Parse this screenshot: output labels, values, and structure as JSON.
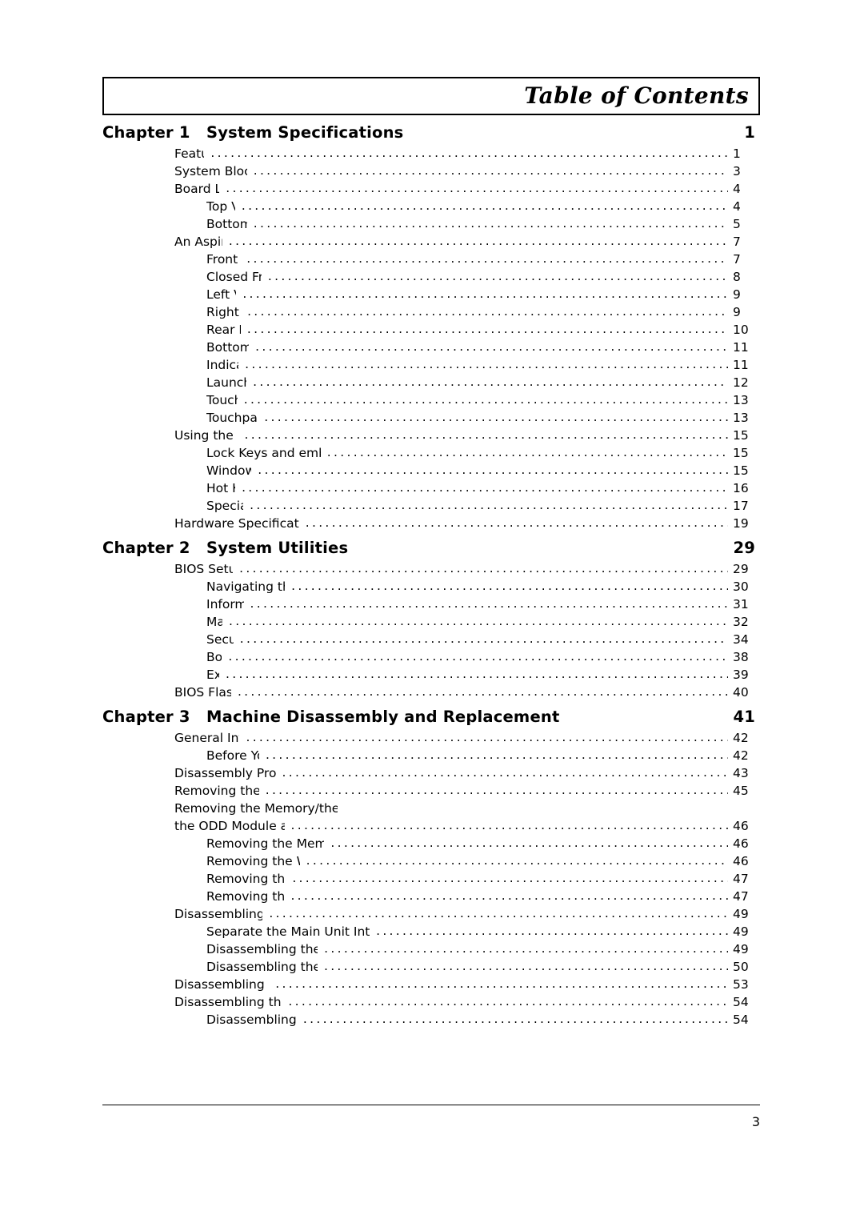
{
  "banner": {
    "title": "Table of Contents"
  },
  "footer": {
    "page_number": "3"
  },
  "chapters": [
    {
      "label": "Chapter 1",
      "title": "System Specifications",
      "page": "1",
      "entries": [
        {
          "text": "Features",
          "page": "1",
          "level": 1
        },
        {
          "text": "System Block Diagram",
          "page": "3",
          "level": 1
        },
        {
          "text": "Board Layout",
          "page": "4",
          "level": 1
        },
        {
          "text": "Top View",
          "page": "4",
          "level": 2
        },
        {
          "text": "Bottom View",
          "page": "5",
          "level": 2
        },
        {
          "text": "An Aspire tour",
          "page": "7",
          "level": 1
        },
        {
          "text": "Front View",
          "page": "7",
          "level": 2
        },
        {
          "text": "Closed Front View",
          "page": "8",
          "level": 2
        },
        {
          "text": "Left View",
          "page": "9",
          "level": 2
        },
        {
          "text": "Right View",
          "page": "9",
          "level": 2
        },
        {
          "text": "Rear Panel",
          "page": "10",
          "level": 2
        },
        {
          "text": "Bottom Panel",
          "page": "11",
          "level": 2
        },
        {
          "text": "Indicators",
          "page": "11",
          "level": 2
        },
        {
          "text": "Launch Keys",
          "page": "12",
          "level": 2
        },
        {
          "text": "Touchpad",
          "page": "13",
          "level": 2
        },
        {
          "text": "Touchpad Basics",
          "page": "13",
          "level": 2
        },
        {
          "text": "Using the Keyboard",
          "page": "15",
          "level": 1
        },
        {
          "text": "Lock Keys and embedded numeric keypad",
          "page": "15",
          "level": 2
        },
        {
          "text": "Windows Keys",
          "page": "15",
          "level": 2
        },
        {
          "text": "Hot Keys",
          "page": "16",
          "level": 2
        },
        {
          "text": "Special Key",
          "page": "17",
          "level": 2
        },
        {
          "text": "Hardware Specifications and Configurations",
          "page": "19",
          "level": 1
        }
      ]
    },
    {
      "label": "Chapter 2",
      "title": "System Utilities",
      "page": "29",
      "entries": [
        {
          "text": "BIOS Setup Utility",
          "page": "29",
          "level": 1
        },
        {
          "text": "Navigating the BIOS Utility",
          "page": "30",
          "level": 2
        },
        {
          "text": "Information",
          "page": "31",
          "level": 2
        },
        {
          "text": "Main",
          "page": "32",
          "level": 2
        },
        {
          "text": "Security",
          "page": "34",
          "level": 2
        },
        {
          "text": "Boot",
          "page": "38",
          "level": 2
        },
        {
          "text": "Exit",
          "page": "39",
          "level": 2
        },
        {
          "text": "BIOS Flash Utility",
          "page": "40",
          "level": 1
        }
      ]
    },
    {
      "label": "Chapter 3",
      "title": "Machine Disassembly and Replacement",
      "page": "41",
      "entries": [
        {
          "text": "General Information",
          "page": "42",
          "level": 1
        },
        {
          "text": "Before You Begin",
          "page": "42",
          "level": 2
        },
        {
          "text": "Disassembly Procedure Flowchart",
          "page": "43",
          "level": 1
        },
        {
          "text": "Removing the Battery Pack",
          "page": "45",
          "level": 1
        },
        {
          "text": "Removing the Memory/the HDD Module/the Wireless LAN Card/",
          "page": "",
          "level": 1,
          "dots": false
        },
        {
          "text": "the ODD Module and the LCD Module",
          "page": "46",
          "level": 1
        },
        {
          "text": "Removing the Memory and the HDD Module",
          "page": "46",
          "level": 2
        },
        {
          "text": "Removing the Wireless LAN Card",
          "page": "46",
          "level": 2
        },
        {
          "text": "Removing the ODD Module",
          "page": "47",
          "level": 2
        },
        {
          "text": "Removing the LCD Module",
          "page": "47",
          "level": 2
        },
        {
          "text": "Disassembling the Main Unit",
          "page": "49",
          "level": 1
        },
        {
          "text": "Separate the Main Unit Into the Upper and the Lower Case Assembly",
          "page": "49",
          "level": 2
        },
        {
          "text": "Disassembling the Upper Case Assembly",
          "page": "49",
          "level": 2
        },
        {
          "text": "Disassembling the Lower Case Assembly",
          "page": "50",
          "level": 2
        },
        {
          "text": "Disassembling the LCD Module",
          "page": "53",
          "level": 1
        },
        {
          "text": "Disassembling the External Modules",
          "page": "54",
          "level": 1
        },
        {
          "text": "Disassembling the HDD Module",
          "page": "54",
          "level": 2
        }
      ]
    }
  ]
}
